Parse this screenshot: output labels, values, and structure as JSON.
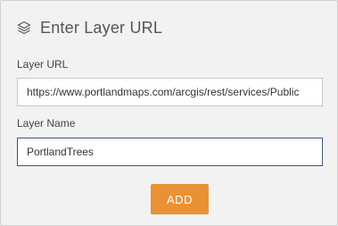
{
  "header": {
    "icon": "layers-icon",
    "title": "Enter Layer URL"
  },
  "form": {
    "url_label": "Layer URL",
    "url_value": "https://www.portlandmaps.com/arcgis/rest/services/Public",
    "name_label": "Layer Name",
    "name_value": "PortlandTrees"
  },
  "actions": {
    "add_label": "ADD"
  },
  "colors": {
    "panel_bg": "#f2f2f2",
    "accent": "#e99133",
    "focus_border": "#3a5a7a"
  }
}
